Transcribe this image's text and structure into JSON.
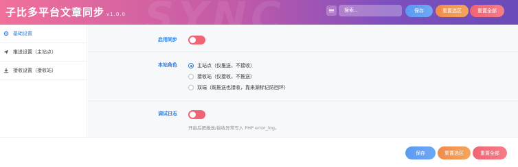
{
  "header": {
    "title": "子比多平台文章同步",
    "version": "v1.0.0",
    "search_placeholder": "搜索...",
    "save_label": "保存",
    "reset_section_label": "重置选区",
    "reset_all_label": "重置全部"
  },
  "sidebar": {
    "items": [
      {
        "label": "基础设置",
        "icon": "gear-icon",
        "active": true
      },
      {
        "label": "推送设置（主站点）",
        "icon": "send-icon",
        "active": false
      },
      {
        "label": "接收设置（接收站）",
        "icon": "download-icon",
        "active": false
      }
    ]
  },
  "settings": {
    "enable_sync": {
      "label": "启用同步",
      "value": false
    },
    "site_role": {
      "label": "本站角色",
      "options": [
        {
          "label": "主站点（仅推送，不接收）",
          "checked": true
        },
        {
          "label": "接收站（仅接收，不推送）",
          "checked": false
        },
        {
          "label": "双端（既推送也接收，靠来源标记防回环）",
          "checked": false
        }
      ]
    },
    "debug_log": {
      "label": "调试日志",
      "value": false,
      "hint": "开启后把推送/接收异常写入 PHP error_log。"
    }
  },
  "footer": {
    "save_label": "保存",
    "reset_section_label": "重置选区",
    "reset_all_label": "重置全部"
  },
  "colors": {
    "accent": "#2f7fe0",
    "toggle_off": "#f06474",
    "save_button": "#5a9bf2",
    "reset_section_button": "#f08b4c",
    "reset_all_button": "#f06474"
  }
}
